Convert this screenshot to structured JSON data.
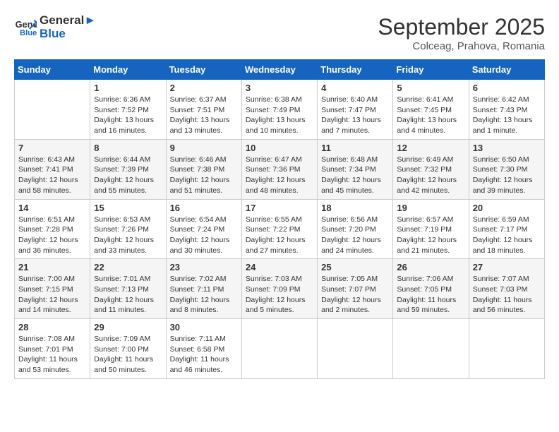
{
  "header": {
    "logo_line1": "General",
    "logo_line2": "Blue",
    "month": "September 2025",
    "location": "Colceag, Prahova, Romania"
  },
  "days_of_week": [
    "Sunday",
    "Monday",
    "Tuesday",
    "Wednesday",
    "Thursday",
    "Friday",
    "Saturday"
  ],
  "weeks": [
    [
      {
        "day": "",
        "info": ""
      },
      {
        "day": "1",
        "info": "Sunrise: 6:36 AM\nSunset: 7:52 PM\nDaylight: 13 hours\nand 16 minutes."
      },
      {
        "day": "2",
        "info": "Sunrise: 6:37 AM\nSunset: 7:51 PM\nDaylight: 13 hours\nand 13 minutes."
      },
      {
        "day": "3",
        "info": "Sunrise: 6:38 AM\nSunset: 7:49 PM\nDaylight: 13 hours\nand 10 minutes."
      },
      {
        "day": "4",
        "info": "Sunrise: 6:40 AM\nSunset: 7:47 PM\nDaylight: 13 hours\nand 7 minutes."
      },
      {
        "day": "5",
        "info": "Sunrise: 6:41 AM\nSunset: 7:45 PM\nDaylight: 13 hours\nand 4 minutes."
      },
      {
        "day": "6",
        "info": "Sunrise: 6:42 AM\nSunset: 7:43 PM\nDaylight: 13 hours\nand 1 minute."
      }
    ],
    [
      {
        "day": "7",
        "info": "Sunrise: 6:43 AM\nSunset: 7:41 PM\nDaylight: 12 hours\nand 58 minutes."
      },
      {
        "day": "8",
        "info": "Sunrise: 6:44 AM\nSunset: 7:39 PM\nDaylight: 12 hours\nand 55 minutes."
      },
      {
        "day": "9",
        "info": "Sunrise: 6:46 AM\nSunset: 7:38 PM\nDaylight: 12 hours\nand 51 minutes."
      },
      {
        "day": "10",
        "info": "Sunrise: 6:47 AM\nSunset: 7:36 PM\nDaylight: 12 hours\nand 48 minutes."
      },
      {
        "day": "11",
        "info": "Sunrise: 6:48 AM\nSunset: 7:34 PM\nDaylight: 12 hours\nand 45 minutes."
      },
      {
        "day": "12",
        "info": "Sunrise: 6:49 AM\nSunset: 7:32 PM\nDaylight: 12 hours\nand 42 minutes."
      },
      {
        "day": "13",
        "info": "Sunrise: 6:50 AM\nSunset: 7:30 PM\nDaylight: 12 hours\nand 39 minutes."
      }
    ],
    [
      {
        "day": "14",
        "info": "Sunrise: 6:51 AM\nSunset: 7:28 PM\nDaylight: 12 hours\nand 36 minutes."
      },
      {
        "day": "15",
        "info": "Sunrise: 6:53 AM\nSunset: 7:26 PM\nDaylight: 12 hours\nand 33 minutes."
      },
      {
        "day": "16",
        "info": "Sunrise: 6:54 AM\nSunset: 7:24 PM\nDaylight: 12 hours\nand 30 minutes."
      },
      {
        "day": "17",
        "info": "Sunrise: 6:55 AM\nSunset: 7:22 PM\nDaylight: 12 hours\nand 27 minutes."
      },
      {
        "day": "18",
        "info": "Sunrise: 6:56 AM\nSunset: 7:20 PM\nDaylight: 12 hours\nand 24 minutes."
      },
      {
        "day": "19",
        "info": "Sunrise: 6:57 AM\nSunset: 7:19 PM\nDaylight: 12 hours\nand 21 minutes."
      },
      {
        "day": "20",
        "info": "Sunrise: 6:59 AM\nSunset: 7:17 PM\nDaylight: 12 hours\nand 18 minutes."
      }
    ],
    [
      {
        "day": "21",
        "info": "Sunrise: 7:00 AM\nSunset: 7:15 PM\nDaylight: 12 hours\nand 14 minutes."
      },
      {
        "day": "22",
        "info": "Sunrise: 7:01 AM\nSunset: 7:13 PM\nDaylight: 12 hours\nand 11 minutes."
      },
      {
        "day": "23",
        "info": "Sunrise: 7:02 AM\nSunset: 7:11 PM\nDaylight: 12 hours\nand 8 minutes."
      },
      {
        "day": "24",
        "info": "Sunrise: 7:03 AM\nSunset: 7:09 PM\nDaylight: 12 hours\nand 5 minutes."
      },
      {
        "day": "25",
        "info": "Sunrise: 7:05 AM\nSunset: 7:07 PM\nDaylight: 12 hours\nand 2 minutes."
      },
      {
        "day": "26",
        "info": "Sunrise: 7:06 AM\nSunset: 7:05 PM\nDaylight: 11 hours\nand 59 minutes."
      },
      {
        "day": "27",
        "info": "Sunrise: 7:07 AM\nSunset: 7:03 PM\nDaylight: 11 hours\nand 56 minutes."
      }
    ],
    [
      {
        "day": "28",
        "info": "Sunrise: 7:08 AM\nSunset: 7:01 PM\nDaylight: 11 hours\nand 53 minutes."
      },
      {
        "day": "29",
        "info": "Sunrise: 7:09 AM\nSunset: 7:00 PM\nDaylight: 11 hours\nand 50 minutes."
      },
      {
        "day": "30",
        "info": "Sunrise: 7:11 AM\nSunset: 6:58 PM\nDaylight: 11 hours\nand 46 minutes."
      },
      {
        "day": "",
        "info": ""
      },
      {
        "day": "",
        "info": ""
      },
      {
        "day": "",
        "info": ""
      },
      {
        "day": "",
        "info": ""
      }
    ]
  ]
}
